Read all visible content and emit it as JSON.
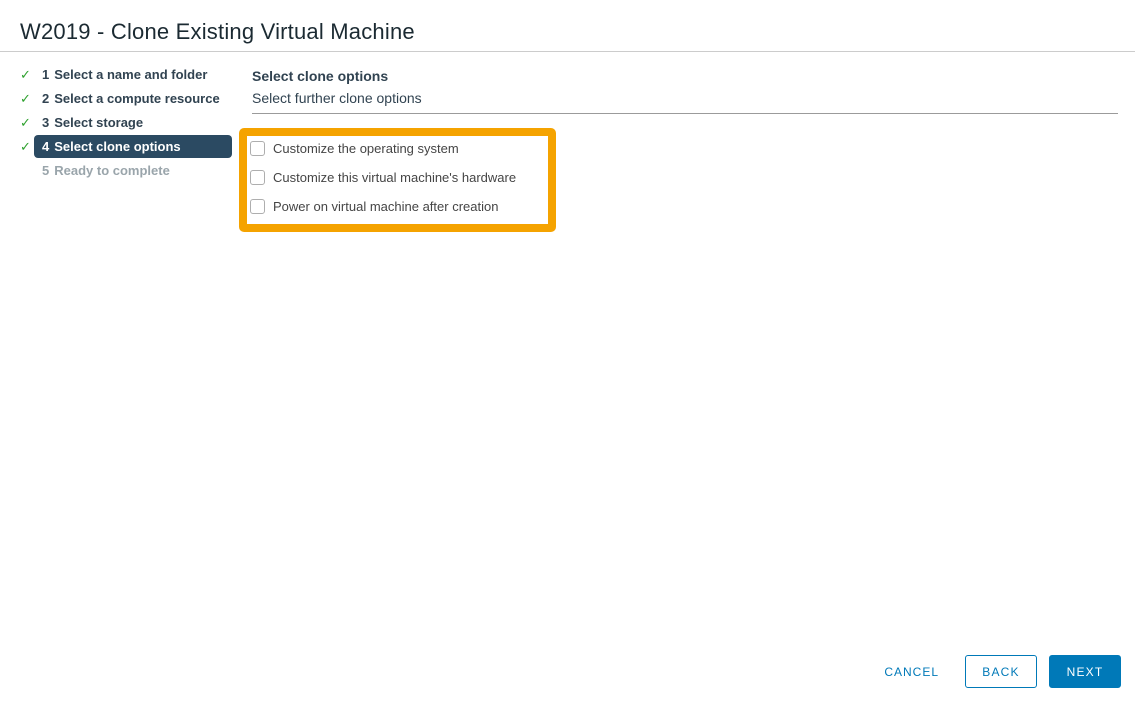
{
  "window": {
    "title": "W2019 - Clone Existing Virtual Machine"
  },
  "wizard": {
    "steps": [
      {
        "number": "1",
        "label": "Select a name and folder",
        "status": "done"
      },
      {
        "number": "2",
        "label": "Select a compute resource",
        "status": "done"
      },
      {
        "number": "3",
        "label": "Select storage",
        "status": "done"
      },
      {
        "number": "4",
        "label": "Select clone options",
        "status": "active"
      },
      {
        "number": "5",
        "label": "Ready to complete",
        "status": "pending"
      }
    ],
    "check_icon": "✓"
  },
  "content": {
    "heading": "Select clone options",
    "subheading": "Select further clone options",
    "options": [
      {
        "label": "Customize the operating system",
        "checked": false
      },
      {
        "label": "Customize this virtual machine's hardware",
        "checked": false
      },
      {
        "label": "Power on virtual machine after creation",
        "checked": false
      }
    ]
  },
  "footer": {
    "cancel_label": "CANCEL",
    "back_label": "BACK",
    "next_label": "NEXT"
  },
  "colors": {
    "primary_blue": "#0079b8",
    "active_step_bg": "#2b4a62",
    "check_green": "#2ea12e",
    "highlight_orange": "#f5a300",
    "pending_step_text": "#9aa5ab"
  }
}
